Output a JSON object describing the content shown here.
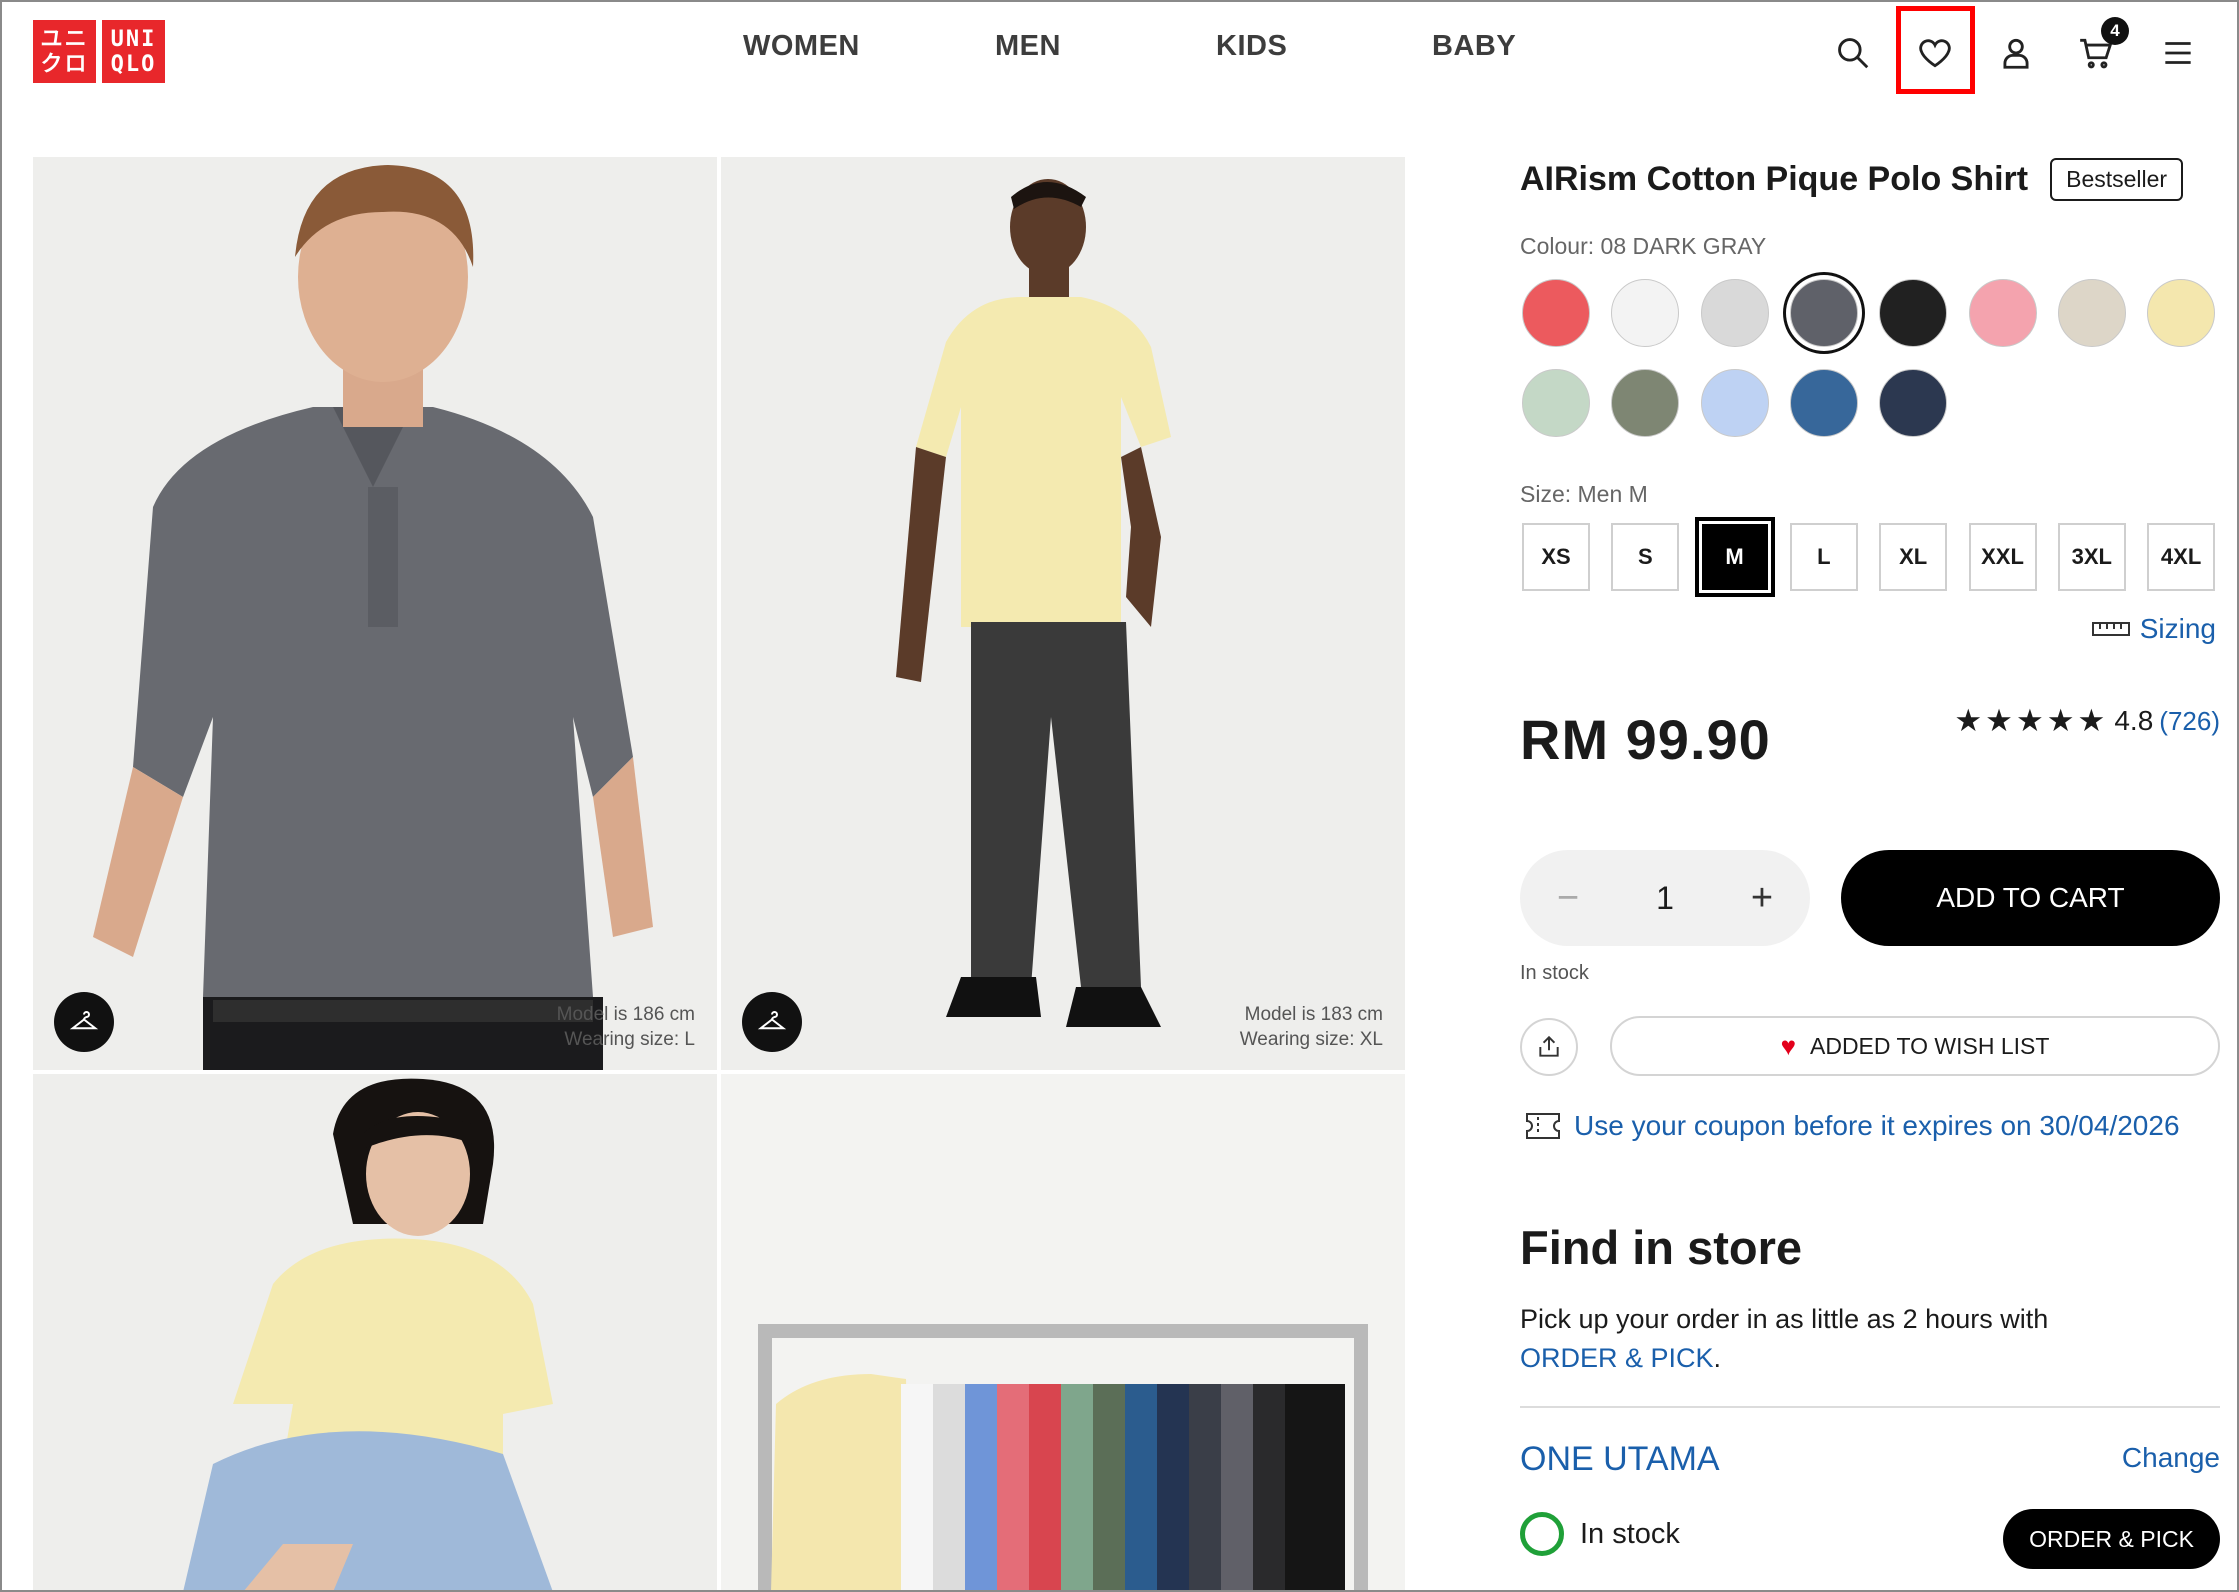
{
  "logo": {
    "row1": [
      "ユニ",
      "UNI"
    ],
    "row2": [
      "クロ",
      "QLO"
    ]
  },
  "nav": {
    "items": [
      "WOMEN",
      "MEN",
      "KIDS",
      "BABY"
    ]
  },
  "header": {
    "cart_count": "4"
  },
  "gallery": {
    "tile1": {
      "model": "Model is 186 cm",
      "wearing": "Wearing size: L"
    },
    "tile2": {
      "model": "Model is 183 cm",
      "wearing": "Wearing size: XL"
    }
  },
  "product": {
    "title": "AIRism Cotton Pique Polo Shirt",
    "tag": "Bestseller",
    "colour_label": "Colour: 08 DARK GRAY",
    "colours": [
      "#ec5a5e",
      "#f3f3f3",
      "#d9d9d9",
      "#5f6169",
      "#212121",
      "#f4a3ae",
      "#ddd6c8",
      "#f4e7ae",
      "#c4d8c6",
      "#7e8673",
      "#bed2f3",
      "#37679a",
      "#2c3850"
    ],
    "size_label": "Size: Men M",
    "sizes": [
      "XS",
      "S",
      "M",
      "L",
      "XL",
      "XXL",
      "3XL",
      "4XL"
    ],
    "sizing": "Sizing",
    "price": "RM 99.90",
    "stars": "★★★★★",
    "rating": "4.8",
    "review_count": "(726)",
    "qty": "1",
    "qty_minus": "−",
    "qty_plus": "+",
    "add_to_cart": "ADD TO CART",
    "stock_text": "In stock",
    "wishlist": "ADDED TO WISH LIST",
    "heart": "♥",
    "coupon": "Use your coupon before it expires on 30/04/2026"
  },
  "store": {
    "title": "Find in store",
    "text": "Pick up your order in as little as 2 hours with",
    "link": "ORDER & PICK",
    "name": "ONE UTAMA",
    "change": "Change",
    "stock": "In stock",
    "button": "ORDER & PICK"
  },
  "colors": {
    "brand": "#e8272b",
    "link": "#1a5fab",
    "highlight": "#ff0000",
    "stock": "#1fa038"
  }
}
